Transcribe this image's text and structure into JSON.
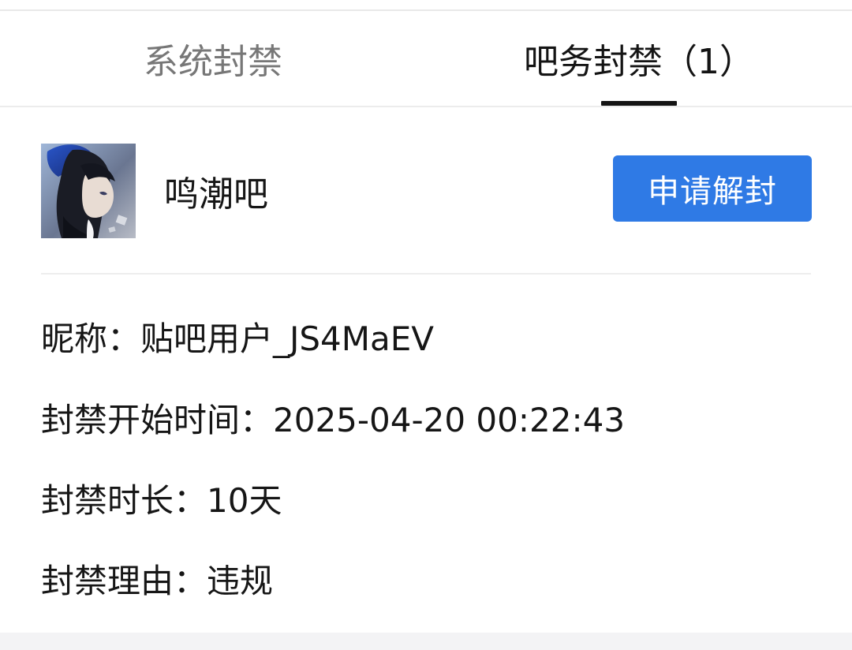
{
  "tabs": [
    {
      "label": "系统封禁",
      "active": false
    },
    {
      "label": "吧务封禁（1）",
      "active": true
    }
  ],
  "bar": {
    "name": "鸣潮吧",
    "unblock_button": "申请解封"
  },
  "details": {
    "nickname": "昵称：贴吧用户_JS4MaEV",
    "start_time": "封禁开始时间：2025-04-20 00:22:43",
    "duration": "封禁时长：10天",
    "reason": "封禁理由：违规"
  },
  "colors": {
    "accent": "#2f7ae5",
    "active_tab": "#141414",
    "inactive_tab": "#777777"
  }
}
